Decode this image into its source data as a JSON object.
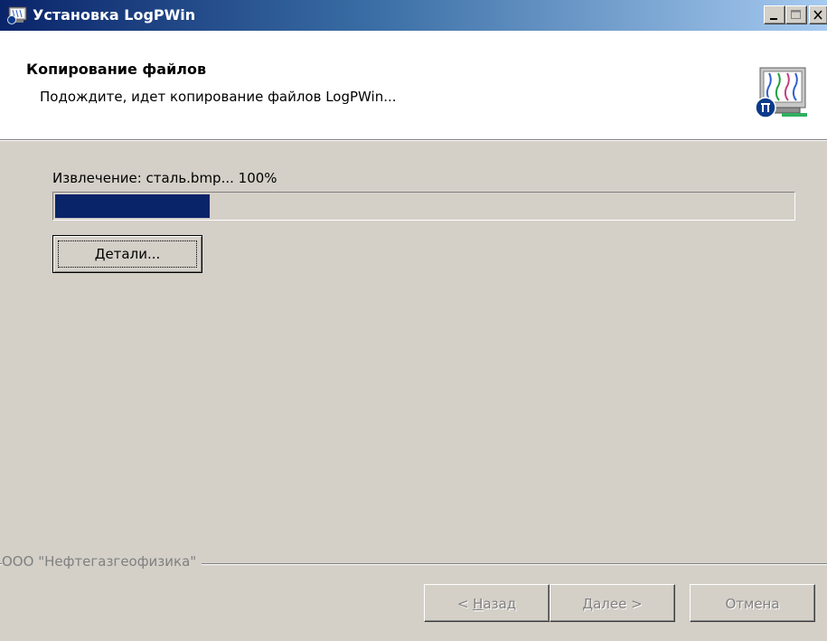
{
  "window": {
    "title": "Установка LogPWin"
  },
  "header": {
    "title": "Копирование файлов",
    "subtitle": "Подождите, идет копирование файлов LogPWin..."
  },
  "progress": {
    "status_text": "Извлечение: сталь.bmp... 100%",
    "fill_fraction": 0.21
  },
  "buttons": {
    "details_label": "Детали...",
    "back_label": "< Назад",
    "next_label": "Далее >",
    "cancel_label": "Отмена"
  },
  "footer": {
    "company": "ООО \"Нефтегазгеофизика\""
  },
  "colors": {
    "progress_fill": "#0a246a",
    "face": "#d4d0c8"
  }
}
